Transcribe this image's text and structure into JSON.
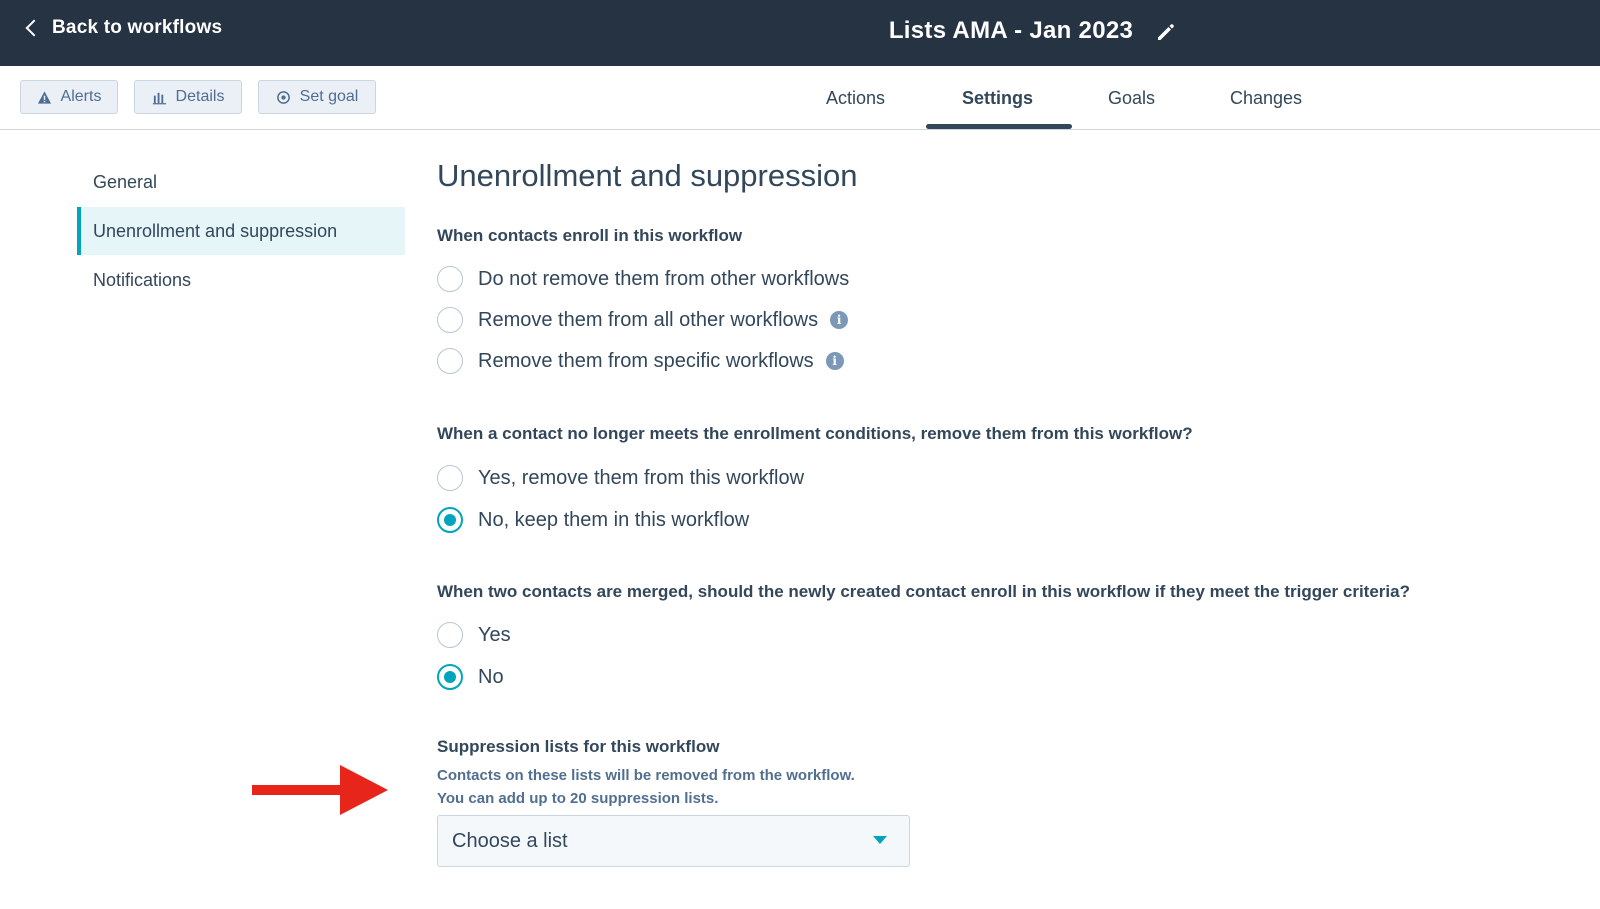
{
  "header": {
    "back_label": "Back to workflows",
    "workflow_title": "Lists AMA - Jan 2023"
  },
  "toolbar": {
    "alerts_label": "Alerts",
    "details_label": "Details",
    "set_goal_label": "Set goal"
  },
  "tabs": [
    {
      "label": "Actions",
      "active": false
    },
    {
      "label": "Settings",
      "active": true
    },
    {
      "label": "Goals",
      "active": false
    },
    {
      "label": "Changes",
      "active": false
    }
  ],
  "sidebar": {
    "items": [
      {
        "label": "General",
        "active": false
      },
      {
        "label": "Unenrollment and suppression",
        "active": true
      },
      {
        "label": "Notifications",
        "active": false
      }
    ]
  },
  "content": {
    "title": "Unenrollment and suppression",
    "enroll_section": {
      "label": "When contacts enroll in this workflow",
      "options": [
        {
          "label": "Do not remove them from other workflows",
          "checked": false
        },
        {
          "label": "Remove them from all other workflows",
          "checked": false,
          "info": true
        },
        {
          "label": "Remove them from specific workflows",
          "checked": false,
          "info": true
        }
      ]
    },
    "conditions_section": {
      "label": "When a contact no longer meets the enrollment conditions, remove them from this workflow?",
      "options": [
        {
          "label": "Yes, remove them from this workflow",
          "checked": false
        },
        {
          "label": "No, keep them in this workflow",
          "checked": true
        }
      ]
    },
    "merge_section": {
      "label": "When two contacts are merged, should the newly created contact enroll in this workflow if they meet the trigger criteria?",
      "options": [
        {
          "label": "Yes",
          "checked": false
        },
        {
          "label": "No",
          "checked": true
        }
      ]
    },
    "suppression_section": {
      "label": "Suppression lists for this workflow",
      "help_line_1": "Contacts on these lists will be removed from the workflow.",
      "help_line_2": "You can add up to 20 suppression lists.",
      "select_value": "Choose a list"
    }
  },
  "colors": {
    "header_bg": "#253342",
    "accent": "#00a4bd",
    "text": "#33475b",
    "annotation_arrow": "#e8251b"
  }
}
